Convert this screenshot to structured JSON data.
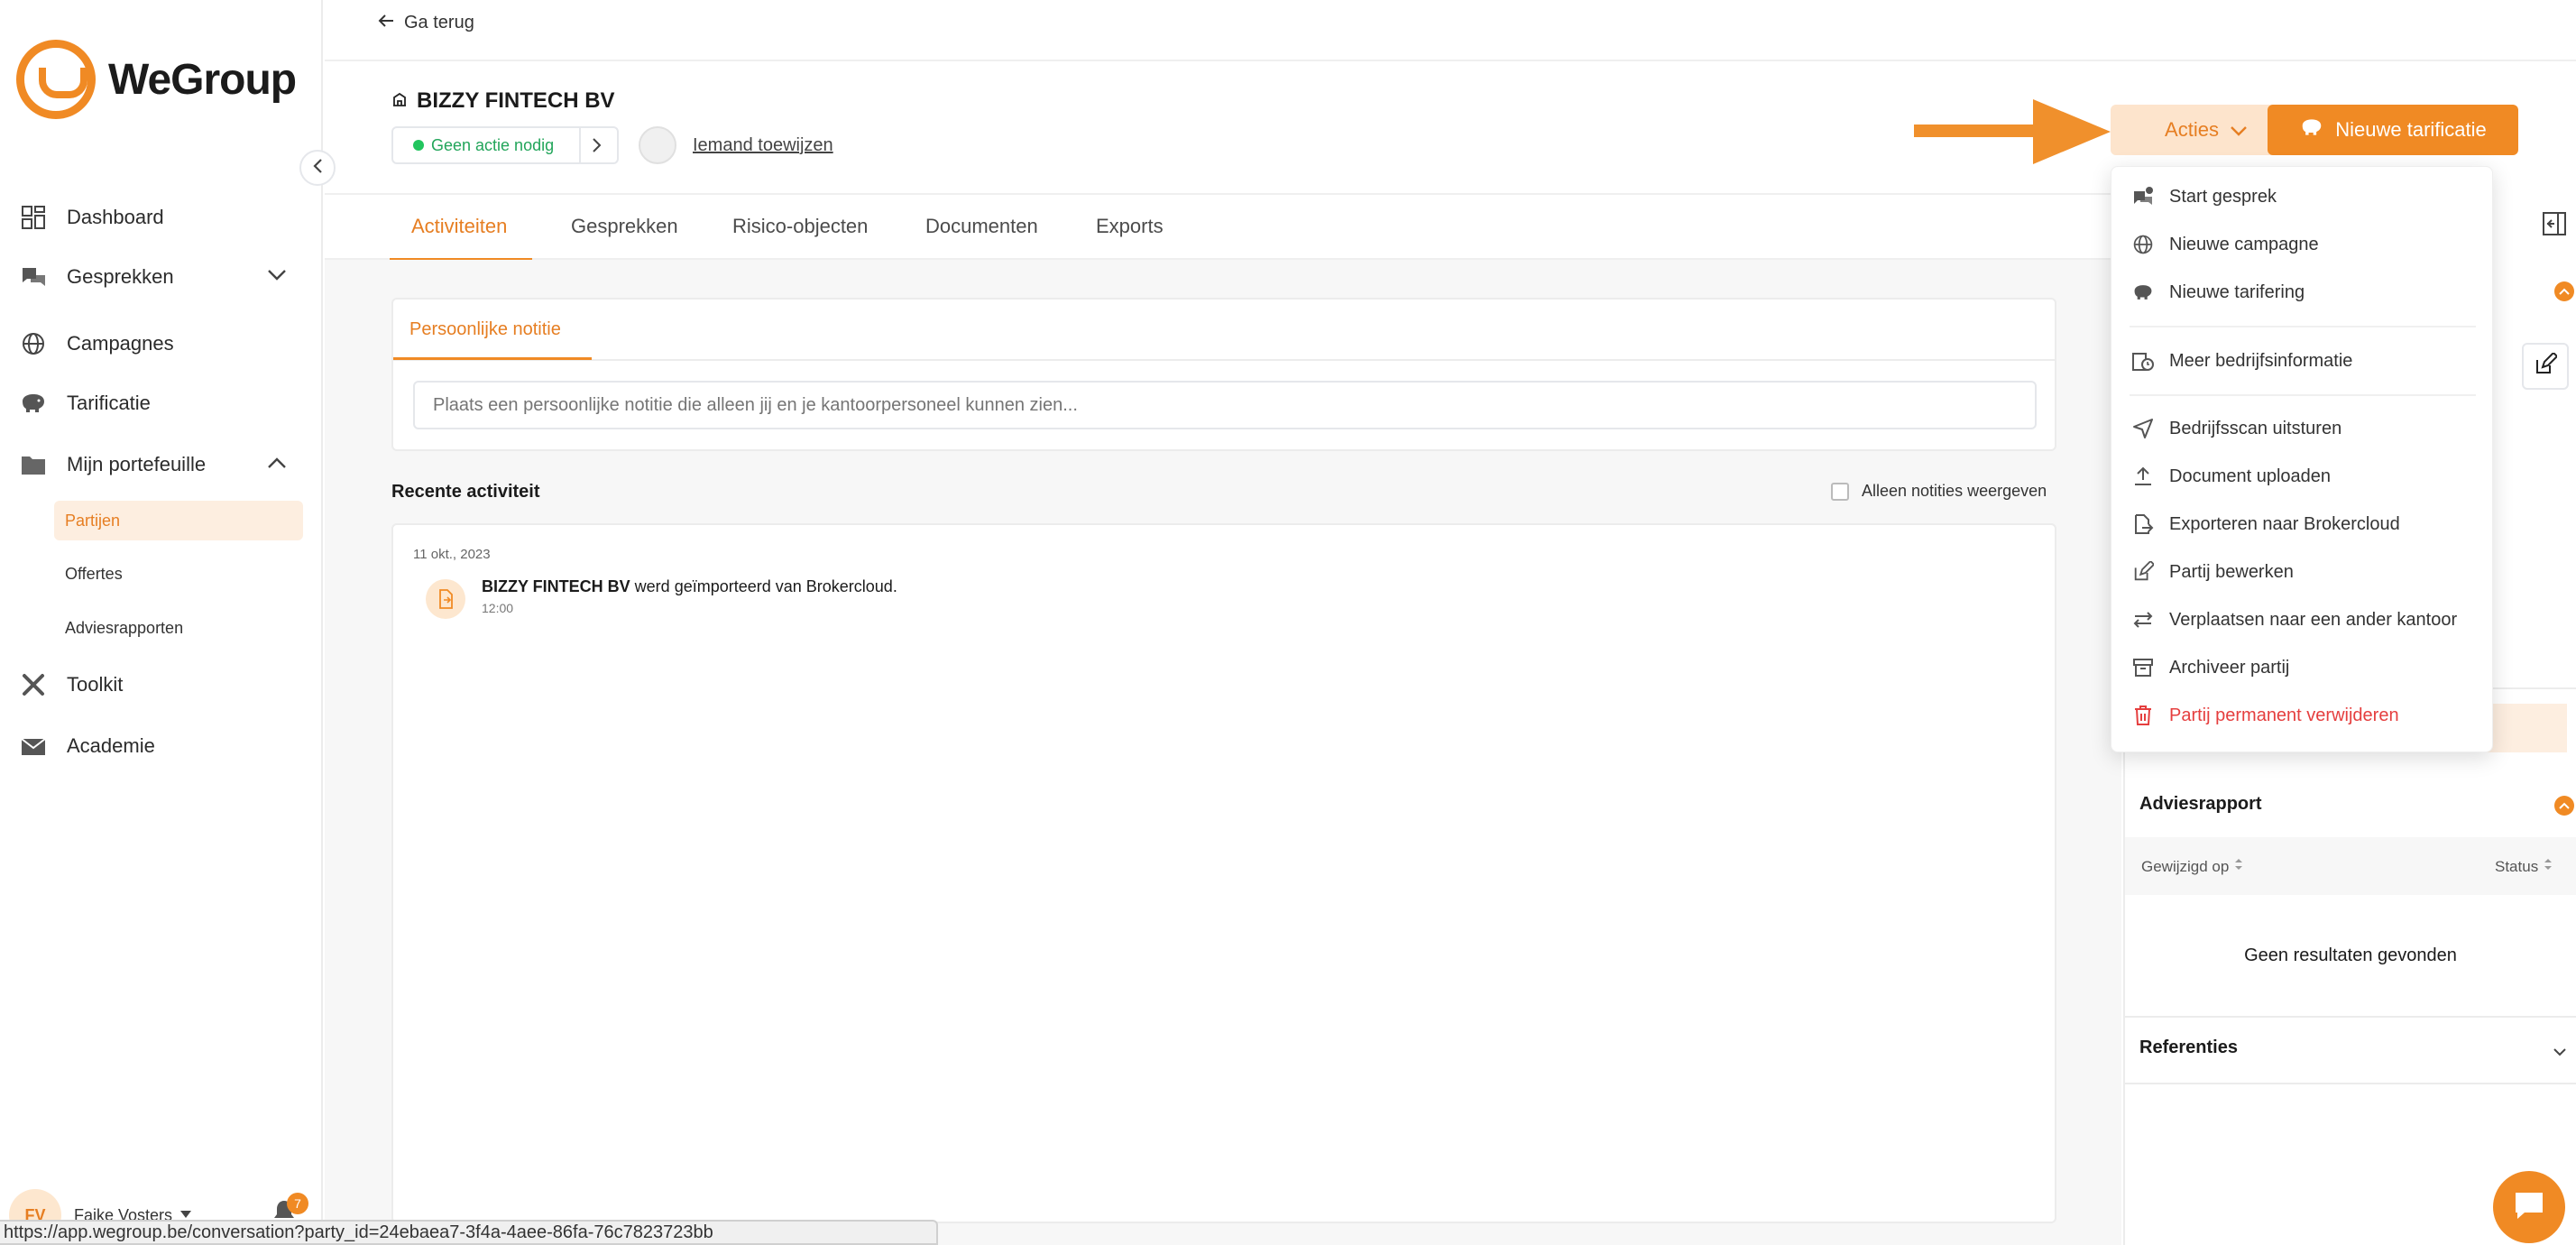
{
  "brand": {
    "name": "WeGroup",
    "accent": "#f08a24",
    "accent_light": "#fde4cc"
  },
  "sidebar": {
    "items": [
      {
        "label": "Dashboard",
        "icon": "dashboard-icon"
      },
      {
        "label": "Gesprekken",
        "icon": "chat-icon"
      },
      {
        "label": "Campagnes",
        "icon": "globe-icon"
      },
      {
        "label": "Tarificatie",
        "icon": "piggybank-icon"
      },
      {
        "label": "Mijn portefeuille",
        "icon": "folder-icon"
      },
      {
        "label": "Toolkit",
        "icon": "tools-icon"
      },
      {
        "label": "Academie",
        "icon": "mail-icon"
      }
    ],
    "sub_items": [
      {
        "label": "Partijen",
        "active": true
      },
      {
        "label": "Offertes",
        "active": false
      },
      {
        "label": "Adviesrapporten",
        "active": false
      }
    ],
    "user": {
      "initials": "FV",
      "name": "Fajke Vosters",
      "notifications": "7"
    }
  },
  "header": {
    "back_label": "Ga terug",
    "company_name": "BIZZY FINTECH BV",
    "status": "Geen actie nodig",
    "assign_label": "Iemand toewijzen",
    "actions_label": "Acties",
    "new_button_label": "Nieuwe tarificatie"
  },
  "tabs": [
    {
      "label": "Activiteiten",
      "active": true
    },
    {
      "label": "Gesprekken",
      "active": false
    },
    {
      "label": "Risico-objecten",
      "active": false
    },
    {
      "label": "Documenten",
      "active": false
    },
    {
      "label": "Exports",
      "active": false
    }
  ],
  "note": {
    "tab_label": "Persoonlijke notitie",
    "placeholder": "Plaats een persoonlijke notitie die alleen jij en je kantoorpersoneel kunnen zien..."
  },
  "recent": {
    "title": "Recente activiteit",
    "filter_label": "Alleen notities weergeven",
    "entries": [
      {
        "date": "11 okt., 2023",
        "subject": "BIZZY FINTECH BV",
        "text": " werd geïmporteerd van Brokercloud.",
        "time": "12:00"
      }
    ]
  },
  "actions_menu": {
    "items": [
      {
        "label": "Start gesprek",
        "icon": "chat-plus-icon",
        "danger": false
      },
      {
        "label": "Nieuwe campagne",
        "icon": "globe-icon",
        "danger": false
      },
      {
        "label": "Nieuwe tarifering",
        "icon": "piggybank-icon",
        "danger": false
      },
      {
        "label": "Meer bedrijfsinformatie",
        "icon": "building-clock-icon",
        "danger": false
      },
      {
        "label": "Bedrijfsscan uitsturen",
        "icon": "send-icon",
        "danger": false
      },
      {
        "label": "Document uploaden",
        "icon": "upload-icon",
        "danger": false
      },
      {
        "label": "Exporteren naar Brokercloud",
        "icon": "export-icon",
        "danger": false
      },
      {
        "label": "Partij bewerken",
        "icon": "edit-icon",
        "danger": false
      },
      {
        "label": "Verplaatsen naar een ander kantoor",
        "icon": "transfer-icon",
        "danger": false
      },
      {
        "label": "Archiveer partij",
        "icon": "archive-icon",
        "danger": false
      },
      {
        "label": "Partij permanent verwijderen",
        "icon": "trash-icon",
        "danger": true
      }
    ]
  },
  "right_panel": {
    "advice_title": "Adviesrapport",
    "col_modified": "Gewijzigd op",
    "col_status": "Status",
    "empty_text": "Geen resultaten gevonden",
    "references_title": "Referenties"
  },
  "statusbar": {
    "url": "https://app.wegroup.be/conversation?party_id=24ebaea7-3f4a-4aee-86fa-76c7823723bb"
  }
}
